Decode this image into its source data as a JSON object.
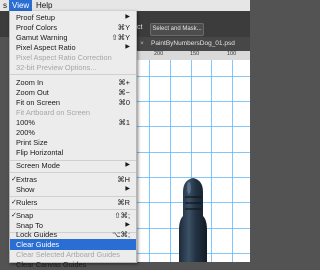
{
  "menubar": {
    "items": [
      {
        "label": "s"
      },
      {
        "label": "View"
      },
      {
        "label": "Help"
      }
    ]
  },
  "options_bar": {
    "partial_label": "ct",
    "select_mask": "Select and Mask..."
  },
  "document": {
    "tab_close": "×",
    "tab_title": "PaintByNumbersDog_01.psd",
    "ruler_ticks": [
      "200",
      "150",
      "100"
    ]
  },
  "view_menu": {
    "items": [
      {
        "label": "Proof Setup",
        "shortcut": "",
        "submenu": true
      },
      {
        "label": "Proof Colors",
        "shortcut": "⌘Y"
      },
      {
        "label": "Gamut Warning",
        "shortcut": "⇧⌘Y"
      },
      {
        "label": "Pixel Aspect Ratio",
        "shortcut": "",
        "submenu": true
      },
      {
        "label": "Pixel Aspect Ratio Correction",
        "disabled": true
      },
      {
        "label": "32-bit Preview Options...",
        "disabled": true
      },
      {
        "label": "Zoom In",
        "shortcut": "⌘+"
      },
      {
        "label": "Zoom Out",
        "shortcut": "⌘−"
      },
      {
        "label": "Fit on Screen",
        "shortcut": "⌘0"
      },
      {
        "label": "Fit Artboard on Screen",
        "disabled": true
      },
      {
        "label": "100%",
        "shortcut": "⌘1"
      },
      {
        "label": "200%",
        "shortcut": ""
      },
      {
        "label": "Print Size",
        "shortcut": ""
      },
      {
        "label": "Flip Horizontal",
        "shortcut": ""
      },
      {
        "label": "Screen Mode",
        "shortcut": "",
        "submenu": true
      },
      {
        "label": "Extras",
        "shortcut": "⌘H",
        "checked": true
      },
      {
        "label": "Show",
        "shortcut": "",
        "submenu": true
      },
      {
        "label": "Rulers",
        "shortcut": "⌘R",
        "checked": true
      },
      {
        "label": "Snap",
        "shortcut": "⇧⌘;",
        "checked": true
      },
      {
        "label": "Snap To",
        "shortcut": "",
        "submenu": true
      },
      {
        "label": "Lock Guides",
        "shortcut": "⌥⌘;"
      },
      {
        "label": "Clear Guides",
        "shortcut": "",
        "highlighted": true
      },
      {
        "label": "Clear Selected Artboard Guides",
        "disabled": true
      },
      {
        "label": "Clear Canvas Guides",
        "shortcut": ""
      }
    ]
  },
  "icons": {
    "submenu": "chevron-right-icon",
    "checkmark": "checkmark-icon"
  },
  "colors": {
    "menu_highlight": "#2b6ed3",
    "guide": "#58b4f7"
  }
}
